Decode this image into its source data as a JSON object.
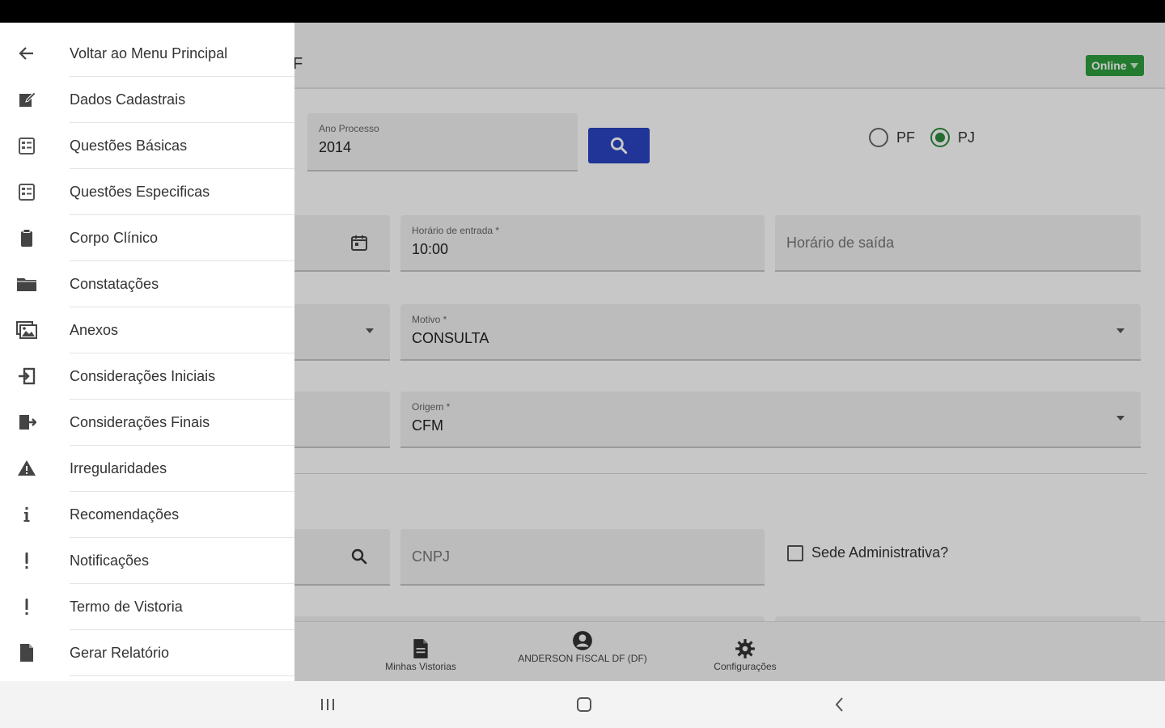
{
  "app": {
    "title": "F",
    "status_chip": "Online",
    "colors": {
      "primary_button": "#2a45c2",
      "status_green": "#2e9e3e",
      "radio_green": "#2e8b3a"
    }
  },
  "form": {
    "ano_processo": {
      "label": "Ano Processo",
      "value": "2014"
    },
    "tipo_pessoa": {
      "options": [
        "PF",
        "PJ"
      ],
      "selected": "PJ"
    },
    "horario_entrada": {
      "label": "Horário de entrada *",
      "value": "10:00"
    },
    "horario_saida": {
      "placeholder": "Horário de saída"
    },
    "motivo": {
      "label": "Motivo *",
      "value": "CONSULTA"
    },
    "origem": {
      "label": "Origem *",
      "value": "CFM"
    },
    "cnpj": {
      "placeholder": "CNPJ"
    },
    "sede_administrativa": {
      "label": "Sede Administrativa?",
      "checked": false
    }
  },
  "bottom_nav": [
    {
      "label": "Minhas Vistorias",
      "icon": "document-icon"
    },
    {
      "label": "ANDERSON FISCAL DF (DF)",
      "icon": "account-circle-icon"
    },
    {
      "label": "Configurações",
      "icon": "gear-icon"
    }
  ],
  "drawer": {
    "items": [
      {
        "label": "Voltar ao Menu Principal",
        "icon": "arrow-back-icon"
      },
      {
        "label": "Dados Cadastrais",
        "icon": "edit-note-icon"
      },
      {
        "label": "Questões Básicas",
        "icon": "checklist-icon"
      },
      {
        "label": "Questões Especificas",
        "icon": "checklist-icon"
      },
      {
        "label": "Corpo Clínico",
        "icon": "clipboard-icon"
      },
      {
        "label": "Constatações",
        "icon": "folder-icon"
      },
      {
        "label": "Anexos",
        "icon": "images-icon"
      },
      {
        "label": "Considerações Iniciais",
        "icon": "sign-in-icon"
      },
      {
        "label": "Considerações Finais",
        "icon": "sign-out-icon"
      },
      {
        "label": "Irregularidades",
        "icon": "warning-icon"
      },
      {
        "label": "Recomendações",
        "icon": "info-icon"
      },
      {
        "label": "Notificações",
        "icon": "exclamation-icon"
      },
      {
        "label": "Termo de Vistoria",
        "icon": "exclamation-icon"
      },
      {
        "label": "Gerar Relatório",
        "icon": "file-icon"
      }
    ]
  },
  "system_nav": [
    {
      "icon": "recent-apps-icon"
    },
    {
      "icon": "home-icon"
    },
    {
      "icon": "back-icon"
    }
  ]
}
